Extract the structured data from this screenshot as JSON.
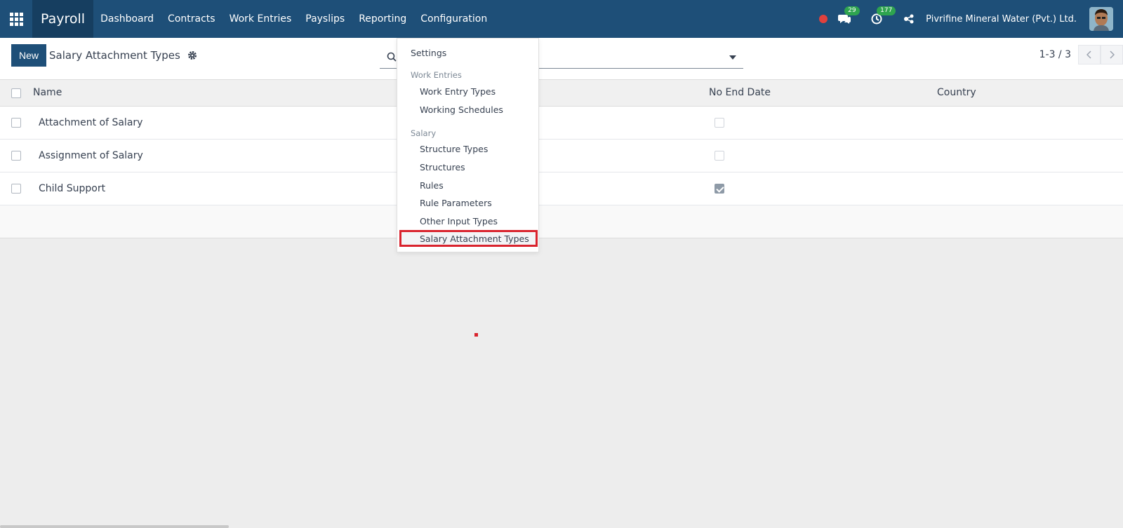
{
  "navbar": {
    "app_name": "Payroll",
    "menu": [
      "Dashboard",
      "Contracts",
      "Work Entries",
      "Payslips",
      "Reporting",
      "Configuration"
    ],
    "messages_count": "29",
    "activities_count": "177",
    "company": "Pivrifine Mineral Water (Pvt.) Ltd."
  },
  "control": {
    "new_label": "New",
    "title": "Salary Attachment Types",
    "pager": "1-3 / 3"
  },
  "list": {
    "columns": [
      "Name",
      "No End Date",
      "Country"
    ],
    "rows": [
      {
        "name": "Attachment of Salary",
        "no_end_date": false
      },
      {
        "name": "Assignment of Salary",
        "no_end_date": false
      },
      {
        "name": "Child Support",
        "no_end_date": true
      }
    ]
  },
  "dropdown": {
    "settings": "Settings",
    "work_entries_header": "Work Entries",
    "work_entries": [
      "Work Entry Types",
      "Working Schedules"
    ],
    "salary_header": "Salary",
    "salary": [
      "Structure Types",
      "Structures",
      "Rules",
      "Rule Parameters",
      "Other Input Types",
      "Salary Attachment Types"
    ]
  },
  "colors": {
    "navbar": "#1e4f78",
    "brand": "#163e60",
    "highlight": "#d9232d",
    "badge": "#2ea44f"
  }
}
